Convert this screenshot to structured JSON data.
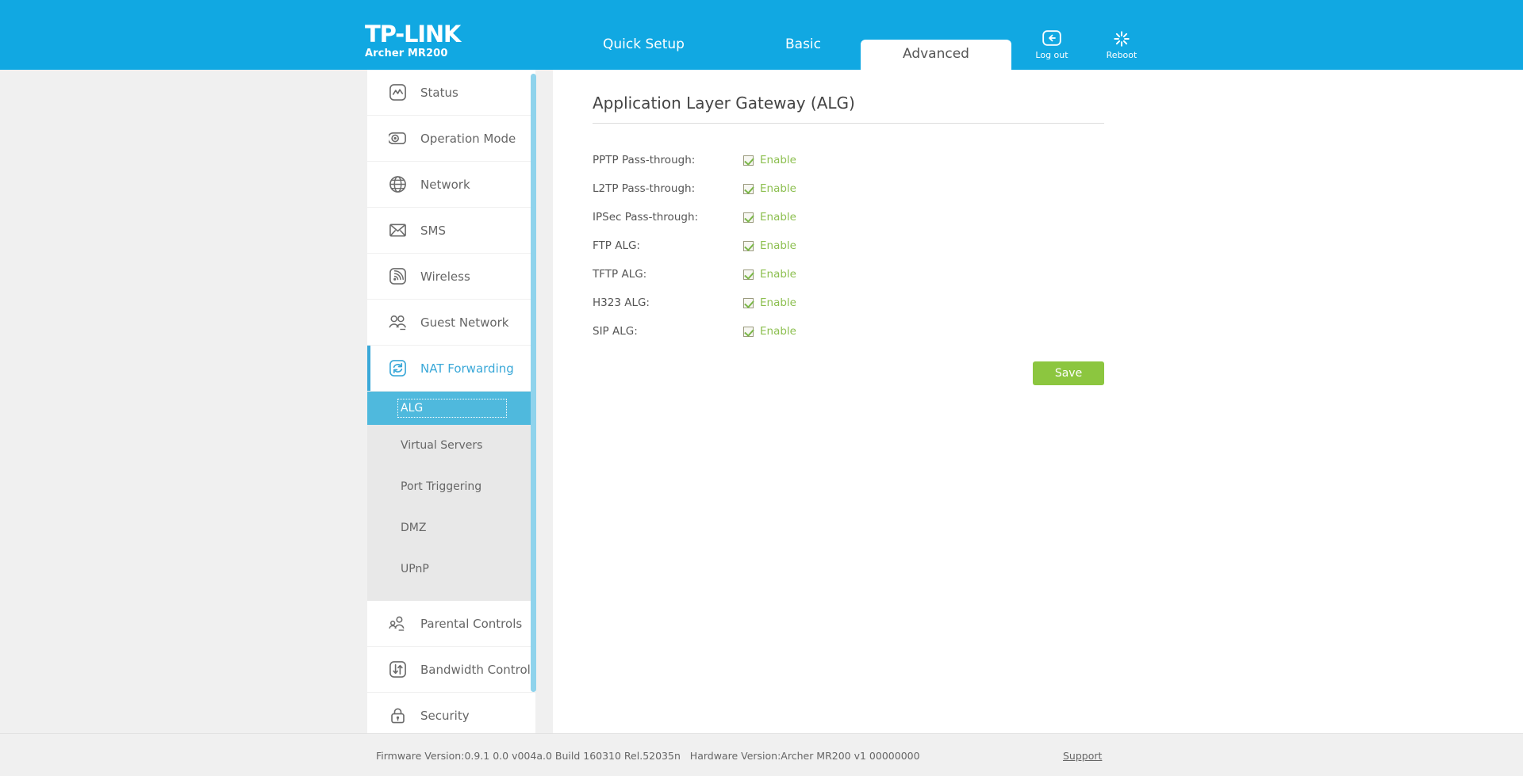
{
  "header": {
    "logo_main": "TP-LINK",
    "logo_sub": "Archer MR200",
    "tabs": [
      {
        "label": "Quick Setup",
        "active": false
      },
      {
        "label": "Basic",
        "active": false
      },
      {
        "label": "Advanced",
        "active": true
      }
    ],
    "actions": [
      {
        "label": "Log out",
        "icon": "logout-icon"
      },
      {
        "label": "Reboot",
        "icon": "reboot-icon"
      }
    ]
  },
  "sidebar": {
    "items": [
      {
        "label": "Status",
        "icon": "status-icon",
        "active": false
      },
      {
        "label": "Operation Mode",
        "icon": "operation-mode-icon",
        "active": false
      },
      {
        "label": "Network",
        "icon": "network-globe-icon",
        "active": false
      },
      {
        "label": "SMS",
        "icon": "sms-envelope-icon",
        "active": false
      },
      {
        "label": "Wireless",
        "icon": "wireless-signal-icon",
        "active": false
      },
      {
        "label": "Guest Network",
        "icon": "guest-network-icon",
        "active": false
      },
      {
        "label": "NAT Forwarding",
        "icon": "nat-forwarding-icon",
        "active": true
      },
      {
        "label": "Parental Controls",
        "icon": "parental-controls-icon",
        "active": false
      },
      {
        "label": "Bandwidth Control",
        "icon": "bandwidth-control-icon",
        "active": false
      },
      {
        "label": "Security",
        "icon": "security-lock-icon",
        "active": false
      }
    ],
    "submenu": [
      {
        "label": "ALG",
        "selected": true
      },
      {
        "label": "Virtual Servers",
        "selected": false
      },
      {
        "label": "Port Triggering",
        "selected": false
      },
      {
        "label": "DMZ",
        "selected": false
      },
      {
        "label": "UPnP",
        "selected": false
      }
    ]
  },
  "main": {
    "title": "Application Layer Gateway (ALG)",
    "rows": [
      {
        "label": "PPTP Pass-through:",
        "checkbox_label": "Enable",
        "checked": true
      },
      {
        "label": "L2TP Pass-through:",
        "checkbox_label": "Enable",
        "checked": true
      },
      {
        "label": "IPSec Pass-through:",
        "checkbox_label": "Enable",
        "checked": true
      },
      {
        "label": "FTP ALG:",
        "checkbox_label": "Enable",
        "checked": true
      },
      {
        "label": "TFTP ALG:",
        "checkbox_label": "Enable",
        "checked": true
      },
      {
        "label": "H323 ALG:",
        "checkbox_label": "Enable",
        "checked": true
      },
      {
        "label": "SIP ALG:",
        "checkbox_label": "Enable",
        "checked": true
      }
    ],
    "save_label": "Save"
  },
  "footer": {
    "version_text": "Firmware Version:0.9.1 0.0 v004a.0 Build 160310 Rel.52035n   Hardware Version:Archer MR200 v1 00000000",
    "support_label": "Support"
  },
  "colors": {
    "header_blue": "#11a8e2",
    "accent_blue": "#3aa8d8",
    "submenu_selected": "#4fb9dd",
    "enable_green": "#8cbf4f",
    "save_green": "#8cc63f",
    "page_gray": "#f0f0f0"
  }
}
